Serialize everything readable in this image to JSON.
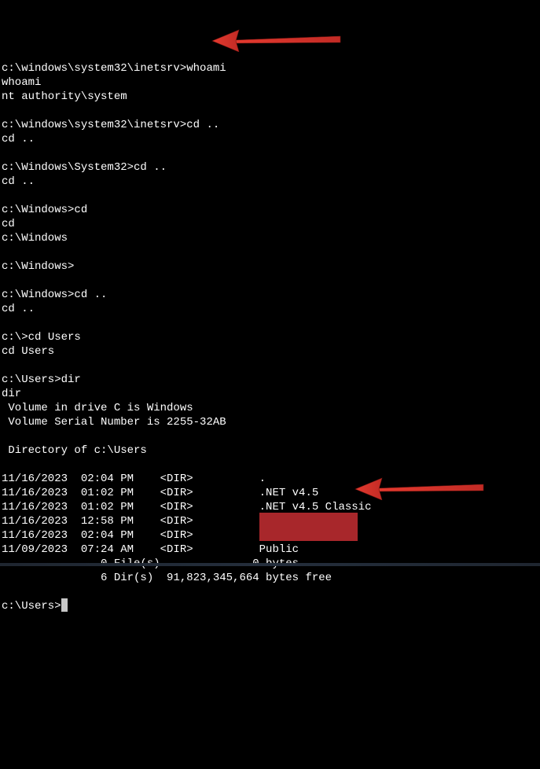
{
  "segments": {
    "s1_prompt1": "c:\\windows\\system32\\inetsrv>",
    "s1_cmd1": "whoami",
    "s1_echo1": "whoami",
    "s1_out1": "nt authority\\system",
    "s2_prompt1": "c:\\windows\\system32\\inetsrv>",
    "s2_cmd1": "cd ..",
    "s2_echo1": "cd ..",
    "s3_prompt1": "c:\\Windows\\System32>",
    "s3_cmd1": "cd ..",
    "s3_echo1": "cd ..",
    "s4_prompt1": "c:\\Windows>",
    "s4_cmd1": "cd",
    "s4_echo1": "cd",
    "s4_out1": "c:\\Windows",
    "s5_prompt1": "c:\\Windows>",
    "s6_prompt1": "c:\\Windows>",
    "s6_cmd1": "cd ..",
    "s6_echo1": "cd ..",
    "s7_prompt1": "c:\\>",
    "s7_cmd1": "cd Users",
    "s7_echo1": "cd Users",
    "s8_prompt1": "c:\\Users>",
    "s8_cmd1": "dir",
    "s8_echo1": "dir",
    "s8_vol1": " Volume in drive C is Windows",
    "s8_vol2": " Volume Serial Number is 2255-32AB",
    "s8_dirof": " Directory of c:\\Users",
    "dir_l1": "11/16/2023  02:04 PM    <DIR>          .",
    "dir_l2": "11/16/2023  01:02 PM    <DIR>          .NET v4.5",
    "dir_l3": "11/16/2023  01:02 PM    <DIR>          .NET v4.5 Classic",
    "dir_l4a": "11/16/2023  12:58 PM    <DIR>          ",
    "dir_l5a": "11/16/2023  02:04 PM    <DIR>          ",
    "dir_l6": "11/09/2023  07:24 AM    <DIR>          Public",
    "dir_sum1": "               0 File(s)              0 bytes",
    "dir_sum2": "               6 Dir(s)  91,823,345,664 bytes free",
    "s9_prompt1": "c:\\Users>"
  }
}
